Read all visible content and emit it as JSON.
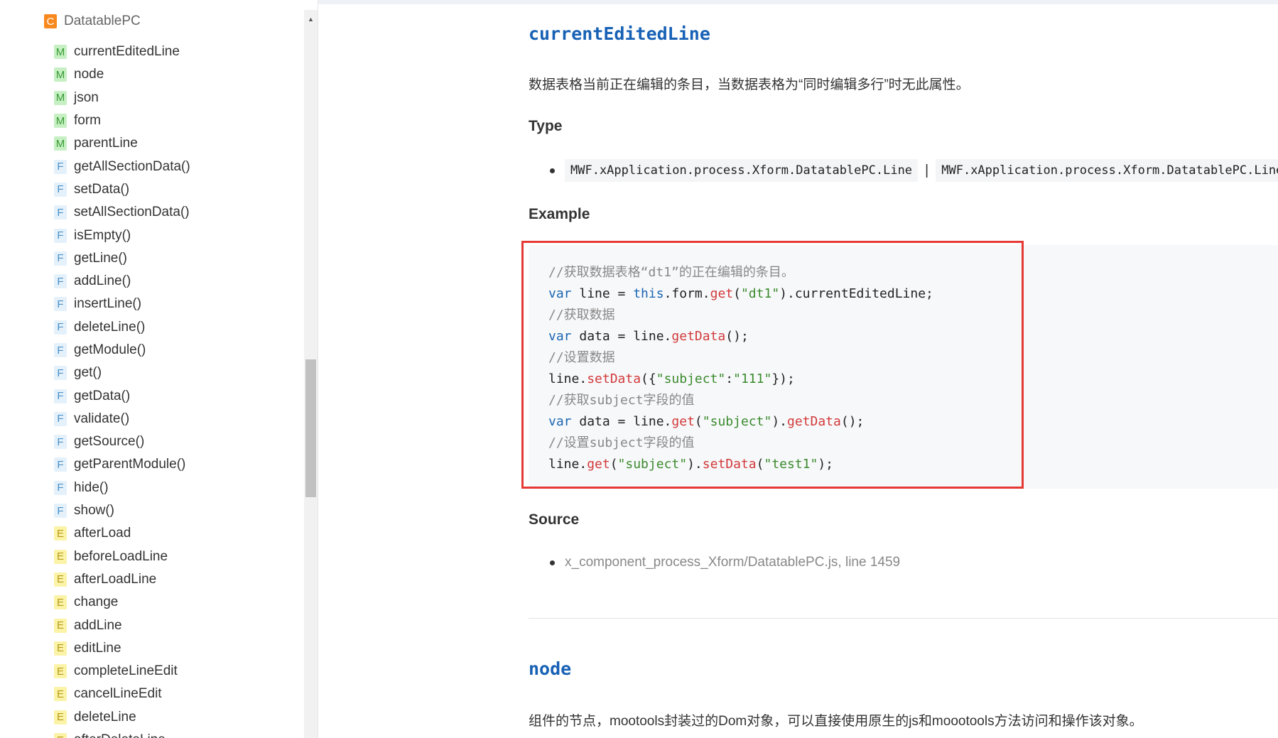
{
  "sidebar": {
    "title": "DatatablePC",
    "title_badge": "C",
    "items": [
      {
        "badge": "M",
        "label": "currentEditedLine"
      },
      {
        "badge": "M",
        "label": "node"
      },
      {
        "badge": "M",
        "label": "json"
      },
      {
        "badge": "M",
        "label": "form"
      },
      {
        "badge": "M",
        "label": "parentLine"
      },
      {
        "badge": "F",
        "label": "getAllSectionData()"
      },
      {
        "badge": "F",
        "label": "setData()"
      },
      {
        "badge": "F",
        "label": "setAllSectionData()"
      },
      {
        "badge": "F",
        "label": "isEmpty()"
      },
      {
        "badge": "F",
        "label": "getLine()"
      },
      {
        "badge": "F",
        "label": "addLine()"
      },
      {
        "badge": "F",
        "label": "insertLine()"
      },
      {
        "badge": "F",
        "label": "deleteLine()"
      },
      {
        "badge": "F",
        "label": "getModule()"
      },
      {
        "badge": "F",
        "label": "get()"
      },
      {
        "badge": "F",
        "label": "getData()"
      },
      {
        "badge": "F",
        "label": "validate()"
      },
      {
        "badge": "F",
        "label": "getSource()"
      },
      {
        "badge": "F",
        "label": "getParentModule()"
      },
      {
        "badge": "F",
        "label": "hide()"
      },
      {
        "badge": "F",
        "label": "show()"
      },
      {
        "badge": "E",
        "label": "afterLoad"
      },
      {
        "badge": "E",
        "label": "beforeLoadLine"
      },
      {
        "badge": "E",
        "label": "afterLoadLine"
      },
      {
        "badge": "E",
        "label": "change"
      },
      {
        "badge": "E",
        "label": "addLine"
      },
      {
        "badge": "E",
        "label": "editLine"
      },
      {
        "badge": "E",
        "label": "completeLineEdit"
      },
      {
        "badge": "E",
        "label": "cancelLineEdit"
      },
      {
        "badge": "E",
        "label": "deleteLine"
      },
      {
        "badge": "E",
        "label": "afterDeleteLine"
      }
    ],
    "scroll_up_glyph": "▲"
  },
  "main": {
    "member1": {
      "title": "currentEditedLine",
      "description": "数据表格当前正在编辑的条目，当数据表格为“同时编辑多行”时无此属性。",
      "type_heading": "Type",
      "type_1": "MWF.xApplication.process.Xform.DatatablePC.Line",
      "type_separator": "|",
      "type_2": "MWF.xApplication.process.Xform.DatatablePC.Line",
      "example_heading": "Example",
      "code": [
        [
          [
            "comment",
            "//获取数据表格“dt1”的正在编辑的条目。"
          ]
        ],
        [
          [
            "kw",
            "var"
          ],
          [
            "plain",
            " line = "
          ],
          [
            "kw",
            "this"
          ],
          [
            "plain",
            ".form."
          ],
          [
            "fn",
            "get"
          ],
          [
            "plain",
            "("
          ],
          [
            "str",
            "\"dt1\""
          ],
          [
            "plain",
            ").currentEditedLine;"
          ]
        ],
        [
          [
            "comment",
            "//获取数据"
          ]
        ],
        [
          [
            "kw",
            "var"
          ],
          [
            "plain",
            " data = line."
          ],
          [
            "fn",
            "getData"
          ],
          [
            "plain",
            "();"
          ]
        ],
        [
          [
            "comment",
            "//设置数据"
          ]
        ],
        [
          [
            "plain",
            "line."
          ],
          [
            "fn",
            "setData"
          ],
          [
            "plain",
            "({"
          ],
          [
            "str",
            "\"subject\""
          ],
          [
            "plain",
            ":"
          ],
          [
            "str",
            "\"111\""
          ],
          [
            "plain",
            "});"
          ]
        ],
        [
          [
            "comment",
            "//获取subject字段的值"
          ]
        ],
        [
          [
            "kw",
            "var"
          ],
          [
            "plain",
            " data = line."
          ],
          [
            "fn",
            "get"
          ],
          [
            "plain",
            "("
          ],
          [
            "str",
            "\"subject\""
          ],
          [
            "plain",
            ")."
          ],
          [
            "fn",
            "getData"
          ],
          [
            "plain",
            "();"
          ]
        ],
        [
          [
            "comment",
            "//设置subject字段的值"
          ]
        ],
        [
          [
            "plain",
            "line."
          ],
          [
            "fn",
            "get"
          ],
          [
            "plain",
            "("
          ],
          [
            "str",
            "\"subject\""
          ],
          [
            "plain",
            ")."
          ],
          [
            "fn",
            "setData"
          ],
          [
            "plain",
            "("
          ],
          [
            "str",
            "\"test1\""
          ],
          [
            "plain",
            ");"
          ]
        ]
      ],
      "source_heading": "Source",
      "source_text": "x_component_process_Xform/DatatablePC.js, line 1459"
    },
    "member2": {
      "title": "node",
      "description": "组件的节点，mootools封装过的Dom对象，可以直接使用原生的js和moootools方法访问和操作该对象。"
    }
  },
  "colors": {
    "member_title": "#1761b5",
    "highlight_border": "#e53935",
    "code_bg": "#f7f8fa"
  }
}
